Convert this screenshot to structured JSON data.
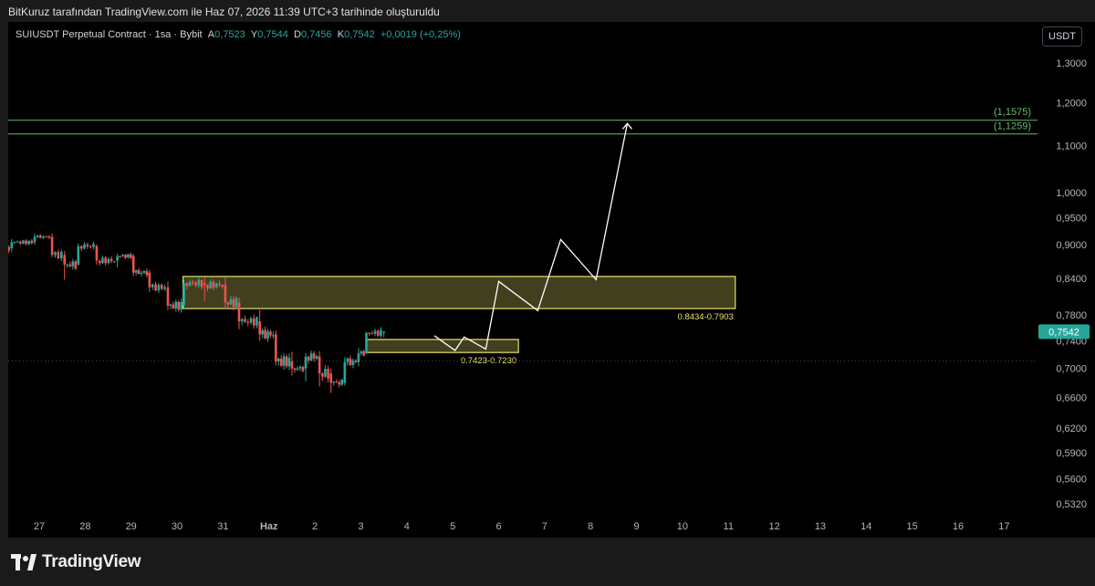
{
  "header": {
    "attribution": "BitKuruz tarafından TradingView.com ile Haz 07, 2026 11:39 UTC+3 tarihinde oluşturuldu"
  },
  "legend": {
    "symbol": "SUIUSDT Perpetual Contract · 1sa · Bybit",
    "open_label": "A",
    "open": "0,7523",
    "high_label": "Y",
    "high": "0,7544",
    "low_label": "D",
    "low": "0,7456",
    "close_label": "K",
    "close": "0,7542",
    "change": "+0,0019 (+0,25%)"
  },
  "currency_button": "USDT",
  "brand": {
    "name": "TradingView"
  },
  "colors": {
    "up": "#26a69a",
    "down": "#ef5350",
    "zone": "#e8e36a",
    "target_line": "#66bb6a",
    "projection": "#ffffff",
    "price_tag": "#26a69a"
  },
  "chart_data": {
    "type": "candlestick",
    "y_scale": "log",
    "ylim": [
      0.508,
      1.38
    ],
    "y_ticks": [
      "1,3000",
      "1,2000",
      "1,1000",
      "1,0000",
      "0,9500",
      "0,9000",
      "0,8400",
      "0,7800",
      "0,7400",
      "0,7000",
      "0,6600",
      "0,6200",
      "0,5900",
      "0,5600",
      "0,5320"
    ],
    "x_ticks": [
      "27",
      "28",
      "29",
      "30",
      "31",
      "Haz",
      "2",
      "3",
      "4",
      "5",
      "6",
      "7",
      "8",
      "9",
      "10",
      "11",
      "12",
      "13",
      "14",
      "15",
      "16",
      "17"
    ],
    "current_price": {
      "value": 0.7542,
      "label": "0,7542"
    },
    "candles": [
      {
        "day": -4.63,
        "o": 1.046,
        "h": 1.055,
        "l": 1.036,
        "c": 1.041
      },
      {
        "day": -4.35,
        "o": 1.041,
        "h": 1.049,
        "l": 1.005,
        "c": 1.012
      },
      {
        "day": -3.9,
        "o": 1.012,
        "h": 1.02,
        "l": 0.998,
        "c": 1.004
      },
      {
        "day": -3.5,
        "o": 1.004,
        "h": 1.014,
        "l": 0.99,
        "c": 0.997
      },
      {
        "day": -3.2,
        "o": 0.997,
        "h": 1.008,
        "l": 0.951,
        "c": 0.956
      },
      {
        "day": -2.95,
        "o": 0.956,
        "h": 0.96,
        "l": 0.894,
        "c": 0.903
      },
      {
        "day": -2.55,
        "o": 0.903,
        "h": 0.915,
        "l": 0.897,
        "c": 0.905
      },
      {
        "day": -2.1,
        "o": 0.905,
        "h": 0.938,
        "l": 0.902,
        "c": 0.932
      },
      {
        "day": -1.6,
        "o": 0.932,
        "h": 0.939,
        "l": 0.905,
        "c": 0.911
      },
      {
        "day": -1.15,
        "o": 0.911,
        "h": 0.925,
        "l": 0.884,
        "c": 0.893
      },
      {
        "day": -0.6,
        "o": 0.893,
        "h": 0.91,
        "l": 0.886,
        "c": 0.904
      },
      {
        "day": -0.1,
        "o": 0.904,
        "h": 0.92,
        "l": 0.899,
        "c": 0.914
      },
      {
        "day": 0.28,
        "o": 0.914,
        "h": 0.92,
        "l": 0.877,
        "c": 0.881
      },
      {
        "day": 0.55,
        "o": 0.881,
        "h": 0.888,
        "l": 0.838,
        "c": 0.864
      },
      {
        "day": 0.85,
        "o": 0.864,
        "h": 0.902,
        "l": 0.862,
        "c": 0.897
      },
      {
        "day": 1.25,
        "o": 0.897,
        "h": 0.9,
        "l": 0.864,
        "c": 0.871
      },
      {
        "day": 1.7,
        "o": 0.871,
        "h": 0.883,
        "l": 0.859,
        "c": 0.879
      },
      {
        "day": 2.05,
        "o": 0.879,
        "h": 0.883,
        "l": 0.844,
        "c": 0.85
      },
      {
        "day": 2.4,
        "o": 0.85,
        "h": 0.855,
        "l": 0.817,
        "c": 0.825
      },
      {
        "day": 2.8,
        "o": 0.825,
        "h": 0.835,
        "l": 0.788,
        "c": 0.795
      },
      {
        "day": 3.15,
        "o": 0.795,
        "h": 0.837,
        "l": 0.79,
        "c": 0.832
      },
      {
        "day": 3.6,
        "o": 0.832,
        "h": 0.843,
        "l": 0.802,
        "c": 0.829
      },
      {
        "day": 4.05,
        "o": 0.829,
        "h": 0.842,
        "l": 0.79,
        "c": 0.8
      },
      {
        "day": 4.35,
        "o": 0.8,
        "h": 0.808,
        "l": 0.758,
        "c": 0.77
      },
      {
        "day": 4.8,
        "o": 0.77,
        "h": 0.788,
        "l": 0.74,
        "c": 0.75
      },
      {
        "day": 5.15,
        "o": 0.75,
        "h": 0.756,
        "l": 0.704,
        "c": 0.71
      },
      {
        "day": 5.5,
        "o": 0.71,
        "h": 0.724,
        "l": 0.69,
        "c": 0.7
      },
      {
        "day": 5.8,
        "o": 0.7,
        "h": 0.722,
        "l": 0.682,
        "c": 0.717
      },
      {
        "day": 6.1,
        "o": 0.717,
        "h": 0.725,
        "l": 0.675,
        "c": 0.693
      },
      {
        "day": 6.35,
        "o": 0.693,
        "h": 0.7,
        "l": 0.666,
        "c": 0.68
      },
      {
        "day": 6.65,
        "o": 0.68,
        "h": 0.716,
        "l": 0.676,
        "c": 0.709
      },
      {
        "day": 6.95,
        "o": 0.709,
        "h": 0.73,
        "l": 0.703,
        "c": 0.722
      },
      {
        "day": 7.12,
        "o": 0.722,
        "h": 0.754,
        "l": 0.72,
        "c": 0.7523
      },
      {
        "day": 7.5,
        "o": 0.7523,
        "h": 0.7544,
        "l": 0.7456,
        "c": 0.7542
      }
    ],
    "zones": [
      {
        "label": "0.8434-0.7903",
        "high": 0.8434,
        "low": 0.7903,
        "day_start": 3.13,
        "day_end": 15.15
      },
      {
        "label": "0.7423-0.7230",
        "high": 0.7423,
        "low": 0.723,
        "day_start": 7.12,
        "day_end": 10.43
      }
    ],
    "target_levels": [
      {
        "value": 1.1575,
        "label": "(1,1575)"
      },
      {
        "value": 1.1259,
        "label": "(1,1259)"
      }
    ],
    "projection_path": [
      [
        8.6,
        0.748
      ],
      [
        9.05,
        0.726
      ],
      [
        9.25,
        0.746
      ],
      [
        9.72,
        0.728
      ],
      [
        10.0,
        0.835
      ],
      [
        10.85,
        0.787
      ],
      [
        11.35,
        0.909
      ],
      [
        12.12,
        0.838
      ],
      [
        12.8,
        1.15
      ]
    ]
  }
}
